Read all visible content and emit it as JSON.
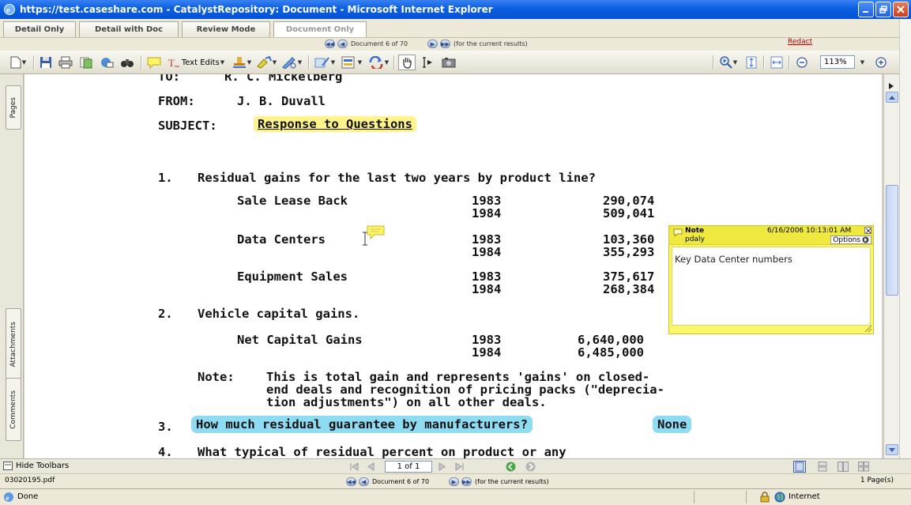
{
  "window": {
    "title": "https://test.caseshare.com - CatalystRepository: Document - Microsoft Internet Explorer"
  },
  "mode_tabs": [
    "Detail Only",
    "Detail with Doc",
    "Review Mode",
    "Document Only"
  ],
  "nav": {
    "doc_label": "Document 6 of 70",
    "results_label": "(for the current results)"
  },
  "redact_label": "Redact",
  "toolbar": {
    "text_edits_label": "Text Edits",
    "zoom_value": "113%"
  },
  "side_tabs": {
    "pages": "Pages",
    "attachments": "Attachments",
    "comments": "Comments"
  },
  "document": {
    "to_line": "TO:      R. C. Mickelberg",
    "from_label": "FROM:",
    "from_value": "J. B. Duvall",
    "subject_label": "SUBJECT:",
    "subject_value": "Response to Questions",
    "q1_num": "1.",
    "q1_text": "Residual gains for the last two years by product line?",
    "rows": [
      {
        "label": "Sale Lease Back",
        "years": [
          "1983",
          "1984"
        ],
        "values": [
          "290,074",
          "509,041"
        ]
      },
      {
        "label": "Data Centers",
        "years": [
          "1983",
          "1984"
        ],
        "values": [
          "103,360",
          "355,293"
        ]
      },
      {
        "label": "Equipment Sales",
        "years": [
          "1983",
          "1984"
        ],
        "values": [
          "375,617",
          "268,384"
        ]
      }
    ],
    "q2_num": "2.",
    "q2_text": "Vehicle capital gains.",
    "net_label": "Net Capital Gains",
    "net_years": [
      "1983",
      "1984"
    ],
    "net_values": [
      "6,640,000",
      "6,485,000"
    ],
    "note_label": "Note:",
    "note_lines": [
      "This is total gain and represents 'gains' on closed-",
      "end deals and recognition of pricing packs (\"deprecia-",
      "tion adjustments\") on all other deals."
    ],
    "q3_num": "3.",
    "q3_text": "How much residual guarantee by manufacturers?",
    "q3_answer": "None",
    "q4_num": "4.",
    "q4_text": "What typical of residual percent on product or any"
  },
  "note_popup": {
    "title": "Note",
    "timestamp": "6/16/2006 10:13:01 AM",
    "author": "pdaly",
    "options_label": "Options",
    "body": "Key Data Center numbers"
  },
  "bottom": {
    "hide_toolbars": "Hide Toolbars",
    "page_field": "1 of 1",
    "pages_count": "1 Page(s)",
    "filename": "03020195.pdf"
  },
  "status": {
    "done": "Done",
    "zone": "Internet"
  }
}
